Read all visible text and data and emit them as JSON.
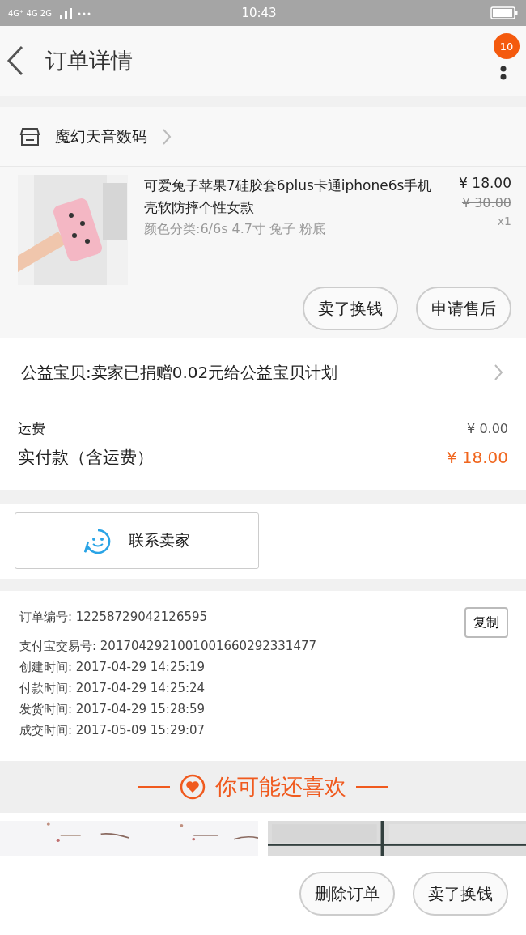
{
  "status_bar": {
    "network": "4G⁺ 4G 2G",
    "time": "10:43"
  },
  "header": {
    "title": "订单详情",
    "badge": "10"
  },
  "shop": {
    "name": "魔幻天音数码"
  },
  "product": {
    "title": "可爱兔子苹果7硅胶套6plus卡通iphone6s手机壳软防摔个性女款",
    "spec": "颜色分类:6/6s 4.7寸 兔子 粉底",
    "price": "¥ 18.00",
    "original_price": "¥ 30.00",
    "quantity": "x1",
    "buttons": [
      "卖了换钱",
      "申请售后"
    ]
  },
  "charity": {
    "text": "公益宝贝:卖家已捐赠0.02元给公益宝贝计划"
  },
  "fees": [
    {
      "label": "运费",
      "value": "¥ 0.00",
      "kind": "plain"
    },
    {
      "label": "实付款（含运费）",
      "value": "¥ 18.00",
      "kind": "total"
    }
  ],
  "contact_button": "联系卖家",
  "order_info": {
    "copy_button": "复制",
    "rows": [
      {
        "label": "订单编号:",
        "value": "12258729042126595"
      },
      {
        "label": "支付宝交易号:",
        "value": "2017042921001001660292331477"
      },
      {
        "label": "创建时间:",
        "value": "2017-04-29 14:25:19"
      },
      {
        "label": "付款时间:",
        "value": "2017-04-29 14:25:24"
      },
      {
        "label": "发货时间:",
        "value": "2017-04-29 15:28:59"
      },
      {
        "label": "成交时间:",
        "value": "2017-05-09 15:29:07"
      }
    ]
  },
  "recommend": {
    "title": "你可能还喜欢"
  },
  "bottom_buttons": [
    "删除订单",
    "卖了换钱"
  ]
}
